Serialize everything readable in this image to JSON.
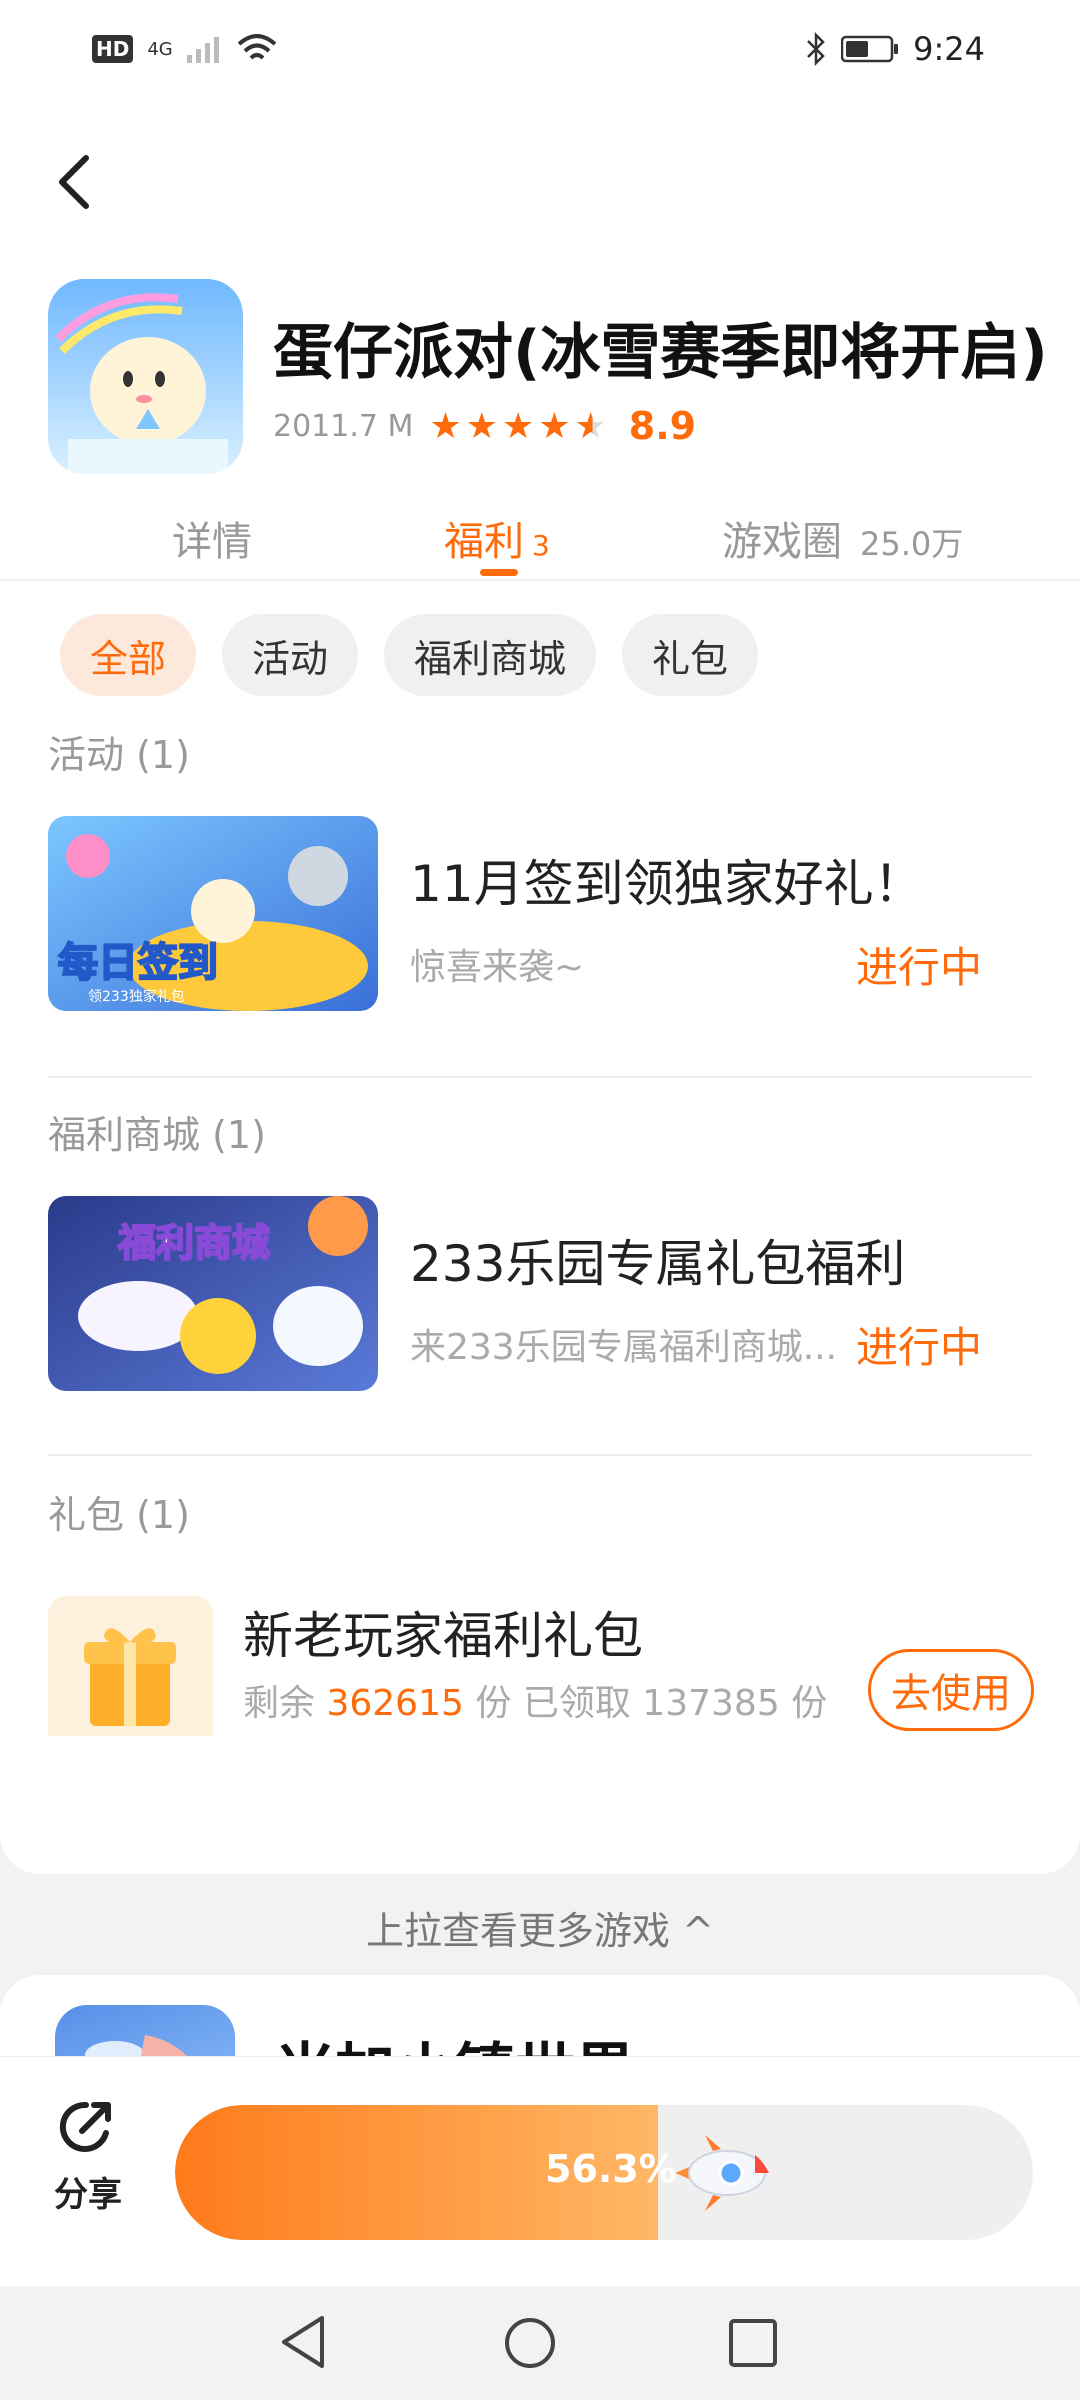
{
  "status_bar": {
    "hd": "HD",
    "network": "4G",
    "time": "9:24"
  },
  "app": {
    "title": "蛋仔派对(冰雪赛季即将开启)",
    "size": "2011.7 M",
    "rating": "8.9",
    "stars": 4.5
  },
  "tabs": [
    {
      "label": "详情",
      "sub": ""
    },
    {
      "label": "福利",
      "sub": "3"
    },
    {
      "label": "游戏圈",
      "sub": "25.0万"
    }
  ],
  "filters": [
    "全部",
    "活动",
    "福利商城",
    "礼包"
  ],
  "sections": {
    "activity": {
      "title": "活动 (1)",
      "item": {
        "title": "11月签到领独家好礼！",
        "desc": "惊喜来袭~",
        "status": "进行中",
        "thumb_text": "每日签到",
        "thumb_sub": "领233独家礼包"
      }
    },
    "mall": {
      "title": "福利商城 (1)",
      "item": {
        "title": "233乐园专属礼包福利",
        "desc": "来233乐园专属福利商城...",
        "status": "进行中",
        "thumb_text": "福利商城"
      }
    },
    "gift": {
      "title": "礼包 (1)",
      "item": {
        "title": "新老玩家福利礼包",
        "remaining_label": "剩余",
        "remaining": "362615",
        "unit1": "份",
        "claimed_label": "已领取",
        "claimed": "137385",
        "unit2": "份",
        "button": "去使用"
      }
    }
  },
  "pull_more": "上拉查看更多游戏 ^",
  "next_game": {
    "title": "米加小镇世界"
  },
  "bottom": {
    "share": "分享",
    "progress_text": "56.3%",
    "progress": 0.563
  },
  "colors": {
    "accent": "#ff6a0a"
  }
}
